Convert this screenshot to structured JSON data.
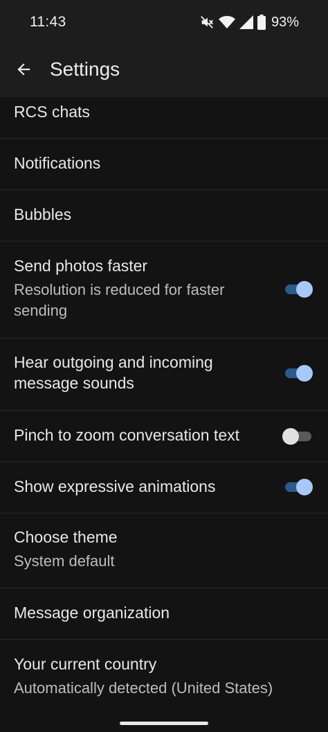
{
  "status_bar": {
    "time": "11:43",
    "battery_percent": "93%",
    "icons": [
      "mute-icon",
      "wifi-icon",
      "signal-icon",
      "battery-icon"
    ]
  },
  "app_bar": {
    "title": "Settings",
    "back_icon": "arrow-back-icon"
  },
  "settings": [
    {
      "title": "RCS chats"
    },
    {
      "title": "Notifications"
    },
    {
      "title": "Bubbles"
    },
    {
      "title": "Send photos faster",
      "subtitle": "Resolution is reduced for faster sending",
      "toggle": true
    },
    {
      "title": "Hear outgoing and incoming message sounds",
      "toggle": true
    },
    {
      "title": "Pinch to zoom conversation text",
      "toggle": false
    },
    {
      "title": "Show expressive animations",
      "toggle": true
    },
    {
      "title": "Choose theme",
      "subtitle": "System default"
    },
    {
      "title": "Message organization"
    },
    {
      "title": "Your current country",
      "subtitle": "Automatically detected (United States)"
    }
  ],
  "colors": {
    "background": "#131313",
    "toggle_on_track": "#2c5a8a",
    "toggle_on_thumb": "#a8c8fa",
    "toggle_off_track": "#5a5a5a",
    "toggle_off_thumb": "#e0e0e0"
  }
}
